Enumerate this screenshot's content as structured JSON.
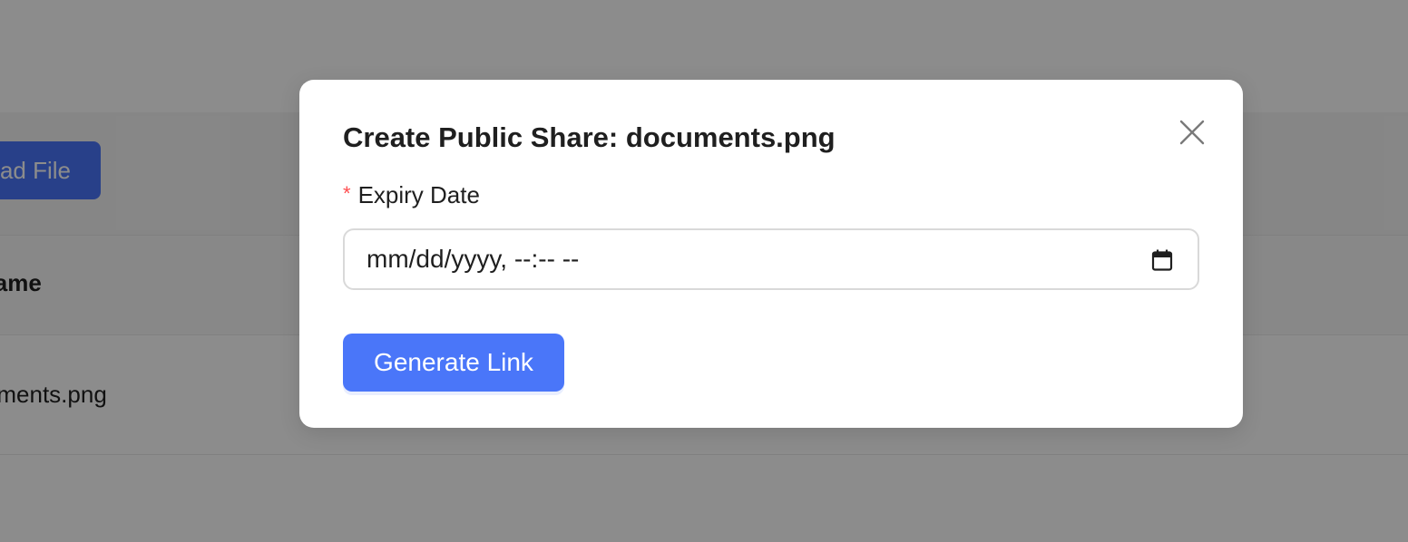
{
  "background": {
    "upload_button_label": "Upload File",
    "table_header_name": "Name",
    "table_row_name": "documents.png"
  },
  "modal": {
    "title": "Create Public Share: documents.png",
    "close_icon": "close-icon",
    "expiry_field": {
      "required_mark": "*",
      "label": "Expiry Date",
      "value_placeholder": "mm/dd/yyyy, --:-- --",
      "icon": "calendar-icon"
    },
    "generate_button_label": "Generate Link"
  },
  "colors": {
    "primary": "#4a76f9",
    "required": "#ff4d4f",
    "overlay": "rgba(0,0,0,0.45)"
  }
}
